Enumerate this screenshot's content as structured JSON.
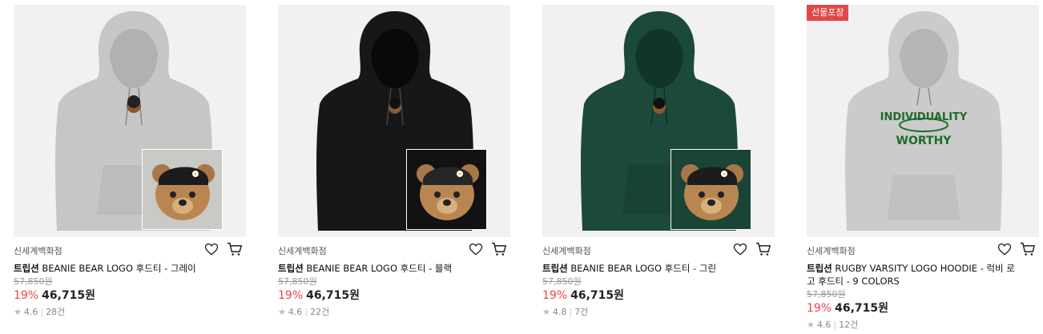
{
  "products": [
    {
      "color": "#c6c6c6",
      "inset_bg": "#c9c9c5",
      "badge": "",
      "brand": "신세계백화점",
      "title_bold": "트립션",
      "title_rest": "BEANIE BEAR LOGO 후드티 - 그레이",
      "original_price": "57,850원",
      "discount": "19%",
      "price": "46,715원",
      "rating": "4.6",
      "reviews": "28건",
      "icons": [
        "heart-icon",
        "cart-icon"
      ]
    },
    {
      "color": "#171717",
      "inset_bg": "#121212",
      "badge": "",
      "brand": "신세계백화점",
      "title_bold": "트립션",
      "title_rest": "BEANIE BEAR LOGO 후드티 - 블랙",
      "original_price": "57,850원",
      "discount": "19%",
      "price": "46,715원",
      "rating": "4.6",
      "reviews": "22건",
      "icons": [
        "heart-icon",
        "cart-icon"
      ]
    },
    {
      "color": "#1c4a3a",
      "inset_bg": "#1a4536",
      "badge": "",
      "brand": "신세계백화점",
      "title_bold": "트립션",
      "title_rest": "BEANIE BEAR LOGO 후드티 - 그린",
      "original_price": "57,850원",
      "discount": "19%",
      "price": "46,715원",
      "rating": "4.8",
      "reviews": "7건",
      "icons": [
        "heart-icon",
        "cart-icon"
      ]
    },
    {
      "color": "#cbcbcb",
      "inset_bg": "",
      "badge": "선물포장",
      "brand": "신세계백화점",
      "title_bold": "트립션",
      "title_rest": "RUGBY VARSITY LOGO HOODIE - 럭비 로고 후드티 - 9 COLORS",
      "original_price": "57,850원",
      "discount": "19%",
      "price": "46,715원",
      "rating": "4.6",
      "reviews": "12건",
      "print_line1": "INDIVIDUALITY",
      "print_line2": "WORTHY",
      "icons": [
        "heart-icon",
        "cart-icon"
      ]
    }
  ],
  "colors": {
    "discount": "#f0424e",
    "badge": "#e04848",
    "print_green": "#1f6b2c"
  }
}
